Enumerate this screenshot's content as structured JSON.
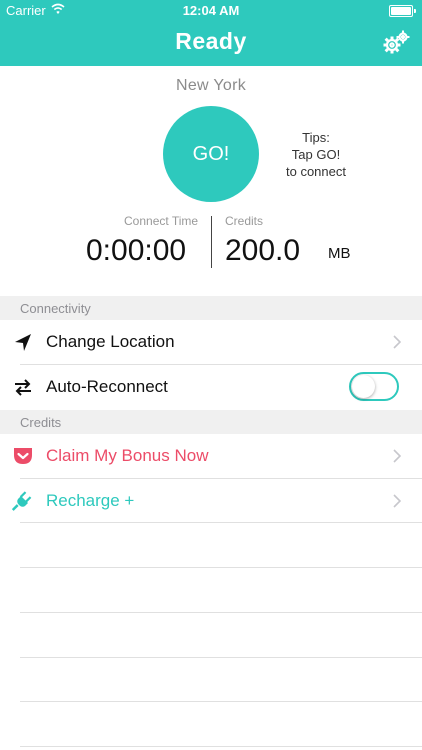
{
  "status_bar": {
    "carrier": "Carrier",
    "time": "12:04 AM"
  },
  "header": {
    "title": "Ready",
    "settings_icon": "gear-icon",
    "background_color": "#2ec9bd"
  },
  "connection": {
    "location": "New York",
    "go_label": "GO!",
    "tips": [
      "Tips:",
      "Tap GO!",
      "to connect"
    ],
    "connect_time_label": "Connect Time",
    "connect_time_value": "0:00:00",
    "credits_label": "Credits",
    "credits_value": "200.0",
    "credits_unit": "MB"
  },
  "sections": {
    "connectivity": "Connectivity",
    "credits": "Credits"
  },
  "connectivity_rows": {
    "change_location": "Change Location",
    "auto_reconnect": "Auto-Reconnect",
    "auto_reconnect_on": false
  },
  "credits_rows": {
    "claim_bonus": "Claim My Bonus Now",
    "recharge": "Recharge +"
  },
  "colors": {
    "accent": "#2ec9bd",
    "bonus": "#ec4c68"
  }
}
